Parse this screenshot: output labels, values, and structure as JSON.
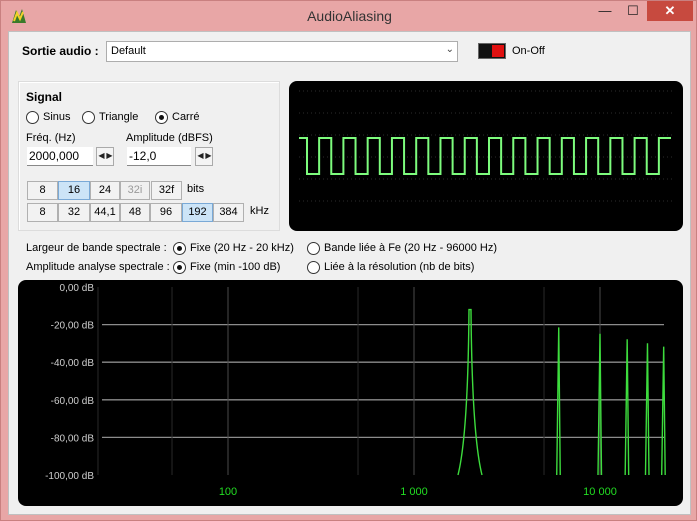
{
  "window": {
    "title": "AudioAliasing",
    "minimize_glyph": "—",
    "maximize_glyph": "☐",
    "close_glyph": "✕"
  },
  "audio_output": {
    "label": "Sortie audio :",
    "selected": "Default",
    "toggle_label": "On-Off",
    "toggle_color": "#e01010"
  },
  "signal": {
    "title": "Signal",
    "waveforms": [
      {
        "label": "Sinus",
        "selected": false
      },
      {
        "label": "Triangle",
        "selected": false
      },
      {
        "label": "Carré",
        "selected": true
      }
    ],
    "freq_label": "Fréq. (Hz)",
    "freq_value": "2000,000",
    "amp_label": "Amplitude (dBFS)",
    "amp_value": "-12,0",
    "bits_buttons": [
      {
        "label": "8",
        "selected": false,
        "disabled": false
      },
      {
        "label": "16",
        "selected": true,
        "disabled": false
      },
      {
        "label": "24",
        "selected": false,
        "disabled": false
      },
      {
        "label": "32i",
        "selected": false,
        "disabled": true
      },
      {
        "label": "32f",
        "selected": false,
        "disabled": false
      }
    ],
    "bits_unit": "bits",
    "rate_buttons": [
      {
        "label": "8",
        "selected": false
      },
      {
        "label": "32",
        "selected": false
      },
      {
        "label": "44,1",
        "selected": false
      },
      {
        "label": "48",
        "selected": false
      },
      {
        "label": "96",
        "selected": false
      },
      {
        "label": "192",
        "selected": true
      },
      {
        "label": "384",
        "selected": false
      }
    ],
    "rate_unit": "kHz"
  },
  "spectral_options": {
    "bandwidth_label": "Largeur de bande spectrale :",
    "bandwidth_fixed": "Fixe (20 Hz - 20 kHz)",
    "bandwidth_fe": "Bande liée à Fe (20 Hz - 96000 Hz)",
    "amplitude_label": "Amplitude analyse spectrale :",
    "amplitude_fixed": "Fixe (min -100 dB)",
    "amplitude_bits": "Liée à la résolution (nb de bits)"
  },
  "scope": {
    "trace_color": "#7dfc7d",
    "cycles_shown": 15
  },
  "spectrum": {
    "y_ticks": [
      "0,00 dB",
      "-20,00 dB",
      "-40,00 dB",
      "-60,00 dB",
      "-80,00 dB",
      "-100,00 dB"
    ],
    "x_ticks": [
      "100",
      "1 000",
      "10 000"
    ],
    "trace_color": "#3ddc3d",
    "tick_color": "#22dd22",
    "peaks_hz": [
      2000,
      6000,
      10000,
      14000,
      18000,
      22000
    ],
    "peaks_db": [
      -12,
      -21.5,
      -24.9,
      -27.8,
      -29.9,
      -31.7
    ]
  }
}
